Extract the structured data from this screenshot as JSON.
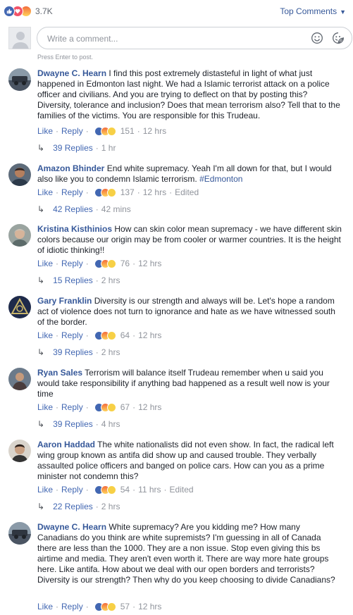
{
  "header": {
    "reaction_count": "3.7K",
    "sort_label": "Top Comments",
    "sort_icon": "caret-down-icon"
  },
  "composer": {
    "placeholder": "Write a comment...",
    "hint": "Press Enter to post.",
    "emoji_icon": "smiley-icon",
    "sticker_icon": "sticker-icon"
  },
  "actions": {
    "like": "Like",
    "reply": "Reply"
  },
  "comments": [
    {
      "name": "Dwayne C. Hearn",
      "text": "I find this post extremely distasteful in light of what just happened in Edmonton last night. We had a Islamic terrorist attack on a police officer and civilians. And you are trying to deflect on that by posting this? Diversity, tolerance and inclusion? Does that mean terrorism also? Tell that to the families of the victims. You are responsible for this Trudeau.",
      "reactions": "151",
      "time": "12 hrs",
      "edited": "",
      "replies": "39 Replies",
      "replies_time": "1 hr"
    },
    {
      "name": "Amazon Bhinder",
      "text": "End white supremacy. Yeah I'm all down for that, but I would also like you to condemn Islamic terrorism.",
      "hashtag": "#Edmonton",
      "reactions": "137",
      "time": "12 hrs",
      "edited": "Edited",
      "replies": "42 Replies",
      "replies_time": "42 mins"
    },
    {
      "name": "Kristina Kisthinios",
      "text": "How can skin color mean supremacy - we have different skin colors because our origin may be from cooler or warmer countries. It is the height of idiotic thinking!!",
      "reactions": "76",
      "time": "12 hrs",
      "edited": "",
      "replies": "15 Replies",
      "replies_time": "2 hrs"
    },
    {
      "name": "Gary Franklin",
      "text": "Diversity is our strength and always will be. Let's hope a random act of violence does not turn to ignorance and hate as we have witnessed south of the border.",
      "reactions": "64",
      "time": "12 hrs",
      "edited": "",
      "replies": "39 Replies",
      "replies_time": "2 hrs"
    },
    {
      "name": "Ryan Sales",
      "text": "Terrorism will balance itself Trudeau remember when u said you would take responsibility if anything bad happened as a result well now is your time",
      "reactions": "67",
      "time": "12 hrs",
      "edited": "",
      "replies": "39 Replies",
      "replies_time": "4 hrs"
    },
    {
      "name": "Aaron Haddad",
      "text": "The white nationalists did not even show. In fact, the radical left wing group known as antifa did show up and caused trouble. They verbally assaulted police officers and banged on police cars. How can you as a prime minister not condemn this?",
      "reactions": "54",
      "time": "11 hrs",
      "edited": "Edited",
      "replies": "22 Replies",
      "replies_time": "2 hrs"
    },
    {
      "name": "Dwayne C. Hearn",
      "text": "White supremacy? Are you kidding me? How many Canadians do you think are white supremists? I'm guessing in all of Canada there are less than the 1000. They are a non issue. Stop even giving this bs airtime and media. They aren't even worth it. There are way more hate groups here. Like antifa. How about we deal with our open borders and terrorists? Diversity is our strength? Then why do you keep choosing to divide Canadians?",
      "reactions": "57",
      "time": "12 hrs",
      "edited": ""
    }
  ]
}
